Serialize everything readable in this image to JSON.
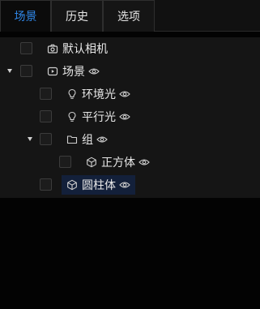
{
  "tabs": [
    {
      "label": "场景",
      "active": true
    },
    {
      "label": "历史",
      "active": false
    },
    {
      "label": "选项",
      "active": false
    }
  ],
  "tree": {
    "nodes": [
      {
        "label": "默认相机",
        "icon": "camera-icon",
        "expanded": null,
        "visible_toggle": false,
        "selected": false
      },
      {
        "label": "场景",
        "icon": "play-icon",
        "expanded": true,
        "visible_toggle": true,
        "selected": false
      },
      {
        "label": "环境光",
        "icon": "lightbulb-icon",
        "expanded": null,
        "visible_toggle": true,
        "selected": false
      },
      {
        "label": "平行光",
        "icon": "lightbulb-icon",
        "expanded": null,
        "visible_toggle": true,
        "selected": false
      },
      {
        "label": "组",
        "icon": "folder-icon",
        "expanded": true,
        "visible_toggle": true,
        "selected": false
      },
      {
        "label": "正方体",
        "icon": "cube-icon",
        "expanded": null,
        "visible_toggle": true,
        "selected": false
      },
      {
        "label": "圆柱体",
        "icon": "cube-icon",
        "expanded": null,
        "visible_toggle": true,
        "selected": true
      }
    ]
  },
  "colors": {
    "accent": "#2f87e8",
    "selected_bg": "#13203a",
    "panel_bg": "#151515",
    "page_bg": "#030303"
  }
}
